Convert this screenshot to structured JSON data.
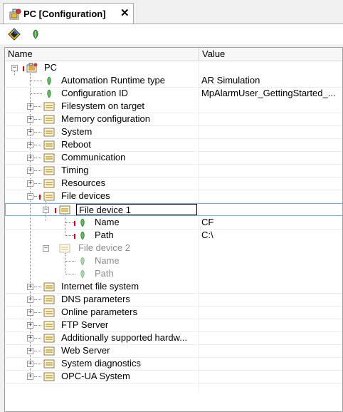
{
  "tab": {
    "title": "PC [Configuration]",
    "close": "✕"
  },
  "toolbar": {
    "icons": [
      "properties-icon",
      "add-leaf-icon"
    ]
  },
  "columns": {
    "name": "Name",
    "value": "Value"
  },
  "tree": {
    "root": "PC",
    "runtime_type": {
      "label": "Automation Runtime type",
      "value": "AR Simulation"
    },
    "config_id": {
      "label": "Configuration ID",
      "value": "MpAlarmUser_GettingStarted_..."
    },
    "groups": [
      "Filesystem on target",
      "Memory configuration",
      "System",
      "Reboot",
      "Communication",
      "Timing",
      "Resources",
      "File devices"
    ],
    "file_device_1": {
      "label": "File device 1",
      "name": {
        "label": "Name",
        "value": "CF"
      },
      "path": {
        "label": "Path",
        "value": "C:\\"
      }
    },
    "file_device_2": {
      "label": "File device 2",
      "name": {
        "label": "Name"
      },
      "path": {
        "label": "Path"
      }
    },
    "groups_after": [
      "Internet file system",
      "DNS parameters",
      "Online parameters",
      "FTP Server",
      "Additionally supported hardw...",
      "Web Server",
      "System diagnostics",
      "OPC-UA System"
    ]
  }
}
